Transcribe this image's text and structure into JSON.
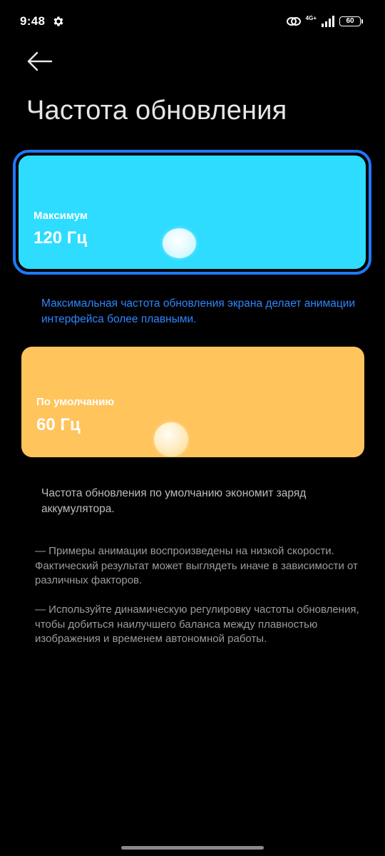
{
  "status_bar": {
    "time": "9:48",
    "network": "4G+",
    "battery": "60"
  },
  "header": {
    "title": "Частота обновления"
  },
  "options": [
    {
      "label": "Максимум",
      "value": "120 Гц",
      "selected": true,
      "color": "#2edcff",
      "description": "Максимальная частота обновления экрана делает анимации интерфейса более плавными."
    },
    {
      "label": "По умолчанию",
      "value": "60 Гц",
      "selected": false,
      "color": "#ffc45c",
      "description": "Частота обновления по умолчанию экономит заряд аккумулятора."
    }
  ],
  "notes": [
    "— Примеры анимации воспроизведены на низкой скорости. Фактический результат может выглядеть иначе в зависимости от различных факторов.",
    "— Используйте динамическую регулировку частоты обновления, чтобы добиться наилучшего баланса между плавностью изображения и временем автономной работы."
  ],
  "colors": {
    "accent": "#1f7aff",
    "accent_text": "#2f86ff",
    "background": "#000000"
  }
}
